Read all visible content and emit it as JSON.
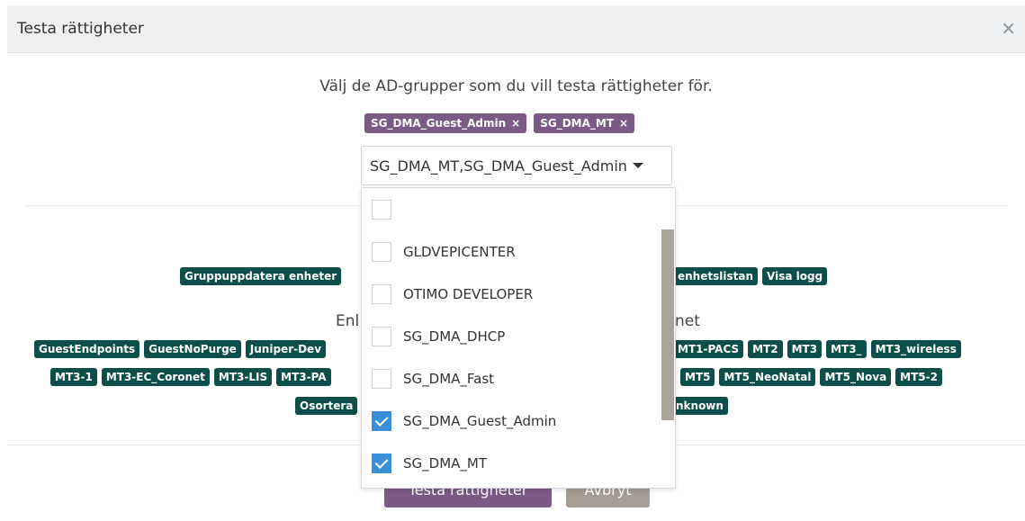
{
  "dialog": {
    "title": "Testa rättigheter",
    "close_glyph": "×"
  },
  "intro": "Välj de AD-grupper som du vill testa rättigheter för.",
  "selected_chips": [
    {
      "label": "SG_DMA_Guest_Admin",
      "remove": "×"
    },
    {
      "label": "SG_DMA_MT",
      "remove": "×"
    }
  ],
  "select": {
    "value": "SG_DMA_MT,SG_DMA_Guest_Admin"
  },
  "dropdown": {
    "options": [
      {
        "label": "",
        "checked": false
      },
      {
        "label": "GLDVEPICENTER",
        "checked": false
      },
      {
        "label": "OTIMO DEVELOPER",
        "checked": false
      },
      {
        "label": "SG_DMA_DHCP",
        "checked": false
      },
      {
        "label": "SG_DMA_Fast",
        "checked": false
      },
      {
        "label": "SG_DMA_Guest_Admin",
        "checked": true
      },
      {
        "label": "SG_DMA_MT",
        "checked": true
      }
    ]
  },
  "permissions": {
    "left_tag": "Gruppuppdatera enheter",
    "right_tags": [
      "enhetslistan",
      "Visa logg"
    ]
  },
  "section_label": {
    "left": "Enl",
    "right": "net"
  },
  "groups": {
    "row1_left": [
      "GuestEndpoints",
      "GuestNoPurge",
      "Juniper-Dev"
    ],
    "row1_right": [
      "MT1-PACS",
      "MT2",
      "MT3",
      "MT3_",
      "MT3_wireless"
    ],
    "row2_left": [
      "MT3-1",
      "MT3-EC_Coronet",
      "MT3-LIS",
      "MT3-PA"
    ],
    "row2_right": [
      "MT5",
      "MT5_NeoNatal",
      "MT5_Nova",
      "MT5-2"
    ],
    "row3_left": [
      "Osortera"
    ],
    "row3_right": [
      "nknown"
    ]
  },
  "buttons": {
    "test": "Testa rättigheter",
    "cancel": "Avbryt"
  },
  "colors": {
    "chip": "#7b5a85",
    "tag": "#0c4f4a",
    "check": "#3a8fd6",
    "cancel": "#a59e95"
  }
}
